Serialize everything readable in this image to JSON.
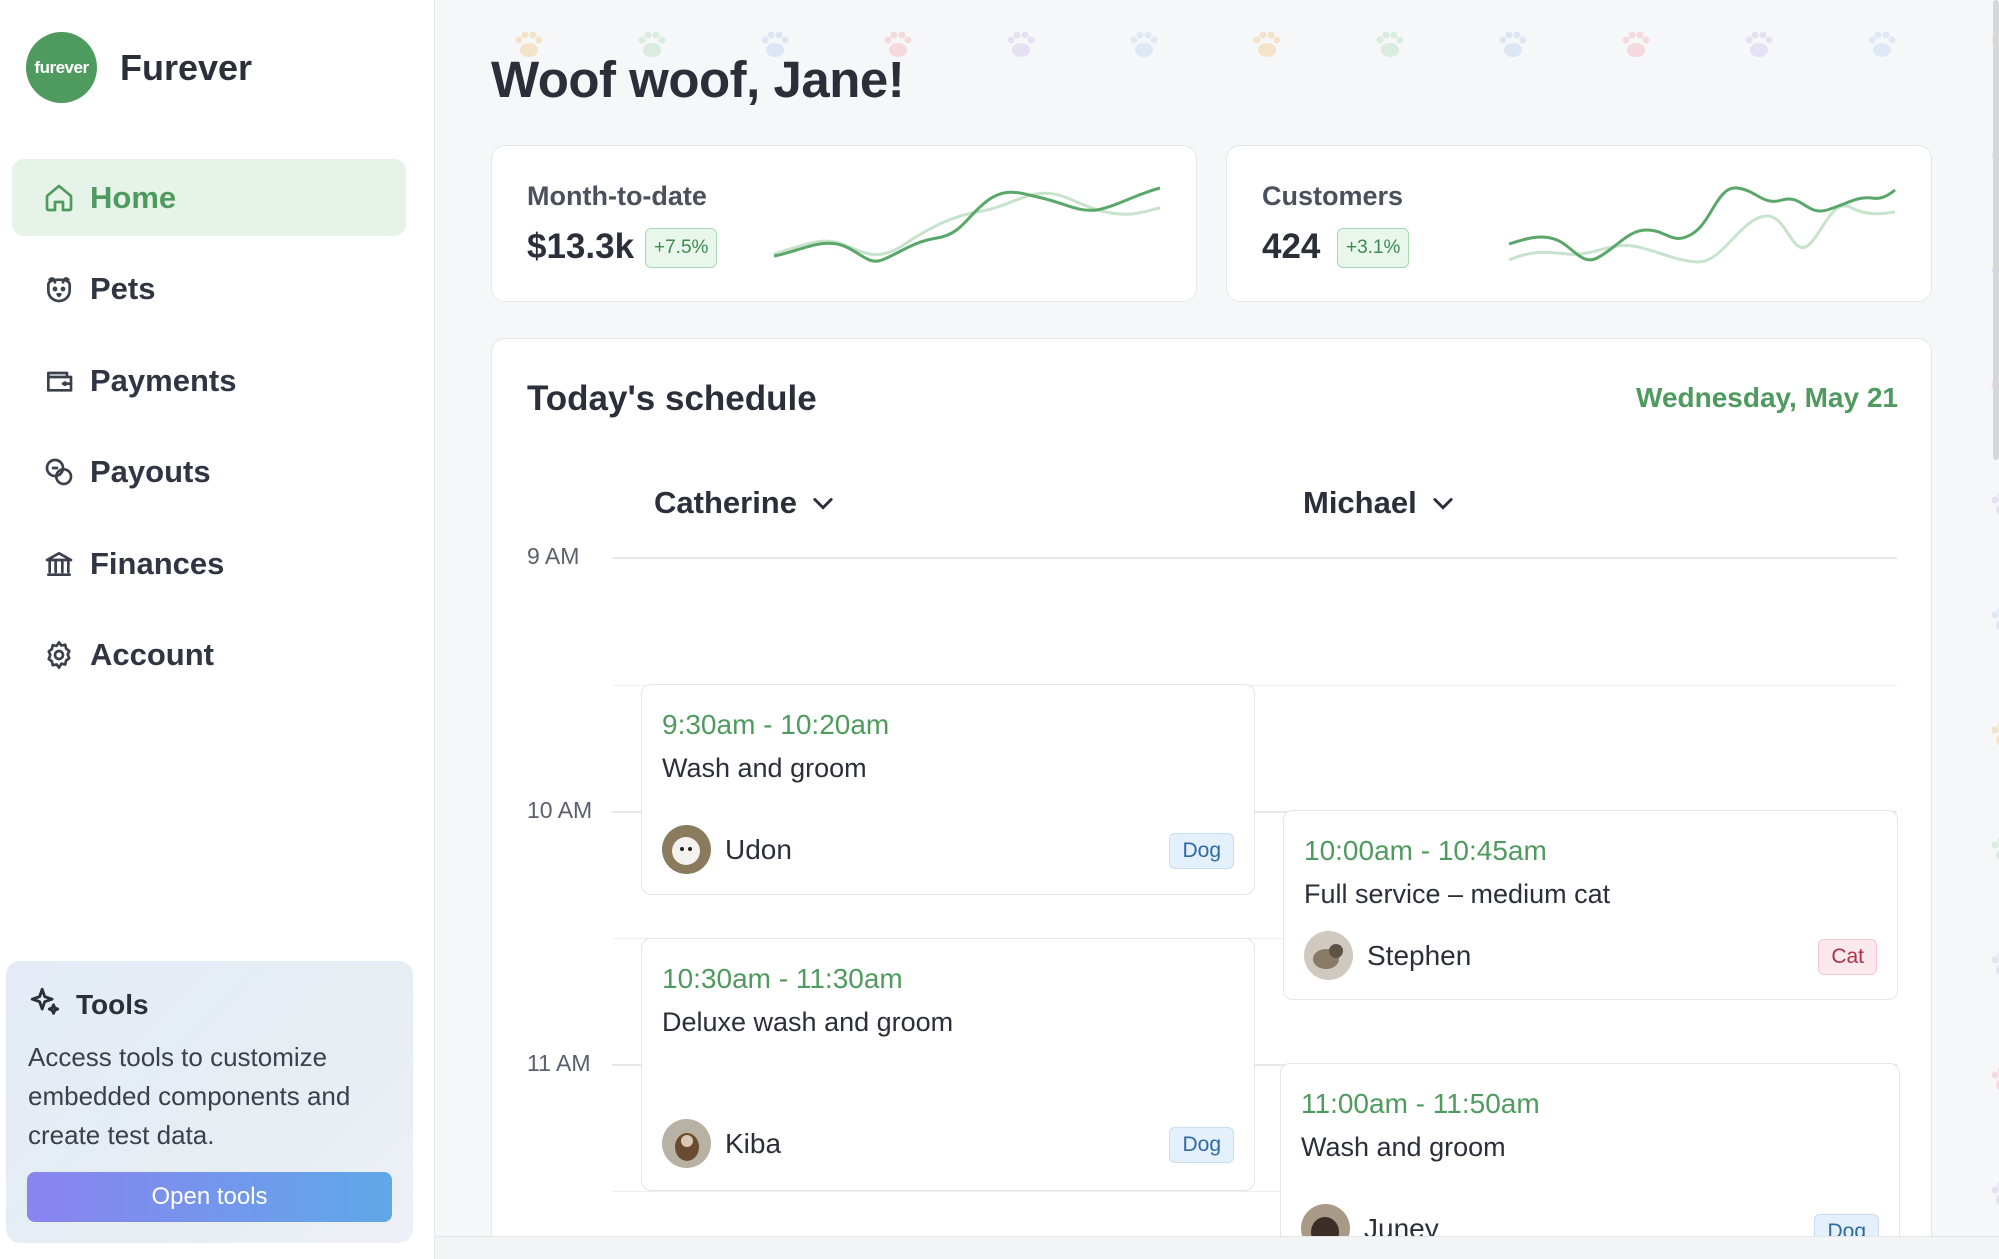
{
  "brand": {
    "logo_text": "furever",
    "name": "Furever",
    "color": "#4f9a5e"
  },
  "nav": {
    "items": [
      {
        "label": "Home",
        "icon": "home-icon",
        "active": true
      },
      {
        "label": "Pets",
        "icon": "pet-face-icon",
        "active": false
      },
      {
        "label": "Payments",
        "icon": "wallet-icon",
        "active": false
      },
      {
        "label": "Payouts",
        "icon": "coins-icon",
        "active": false
      },
      {
        "label": "Finances",
        "icon": "bank-icon",
        "active": false
      },
      {
        "label": "Account",
        "icon": "gear-icon",
        "active": false
      }
    ]
  },
  "tools": {
    "icon": "sparkle-icon",
    "title": "Tools",
    "description": "Access tools to customize embedded components and create test data.",
    "button_label": "Open tools"
  },
  "greeting": "Woof woof, Jane!",
  "stats": [
    {
      "label": "Month-to-date",
      "value": "$13.3k",
      "change": "+7.5%"
    },
    {
      "label": "Customers",
      "value": "424",
      "change": "+3.1%"
    }
  ],
  "schedule": {
    "title": "Today's schedule",
    "date": "Wednesday, May 21",
    "staff": [
      {
        "name": "Catherine"
      },
      {
        "name": "Michael"
      }
    ],
    "time_labels": [
      "9 AM",
      "10 AM",
      "11 AM"
    ],
    "appointments": [
      {
        "staff": "Catherine",
        "time": "9:30am - 10:20am",
        "service": "Wash and groom",
        "pet": "Udon",
        "type": "Dog"
      },
      {
        "staff": "Catherine",
        "time": "10:30am - 11:30am",
        "service": "Deluxe wash and groom",
        "pet": "Kiba",
        "type": "Dog"
      },
      {
        "staff": "Michael",
        "time": "10:00am - 10:45am",
        "service": "Full service – medium cat",
        "pet": "Stephen",
        "type": "Cat"
      },
      {
        "staff": "Michael",
        "time": "11:00am - 11:50am",
        "service": "Wash and groom",
        "pet": "Juney",
        "type": "Dog"
      }
    ]
  },
  "colors": {
    "accent_green": "#4f9a5e",
    "active_nav_bg": "#e5f3e8",
    "dog_tag": "#2f6aa3",
    "cat_tag": "#b0304a"
  }
}
